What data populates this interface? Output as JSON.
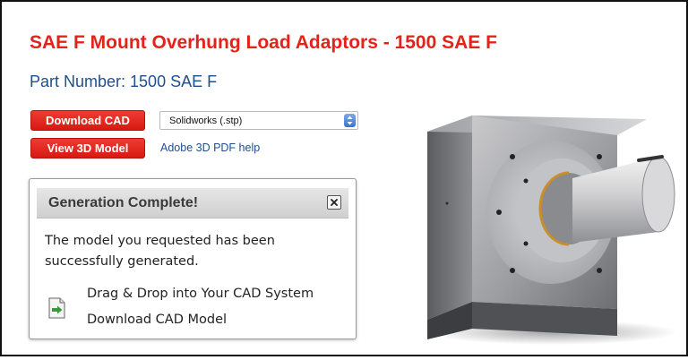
{
  "product": {
    "title": "SAE F Mount Overhung Load Adaptors - 1500 SAE F",
    "part_number": "Part Number: 1500 SAE F"
  },
  "actions": {
    "download_cad_label": "Download CAD",
    "view_3d_label": "View 3D Model",
    "format_selected": "Solidworks (.stp)",
    "pdf_help_link": "Adobe 3D PDF help"
  },
  "panel": {
    "title": "Generation Complete!",
    "message": "The model you requested has been successfully generated.",
    "drag_drop": "Drag & Drop into Your CAD System",
    "download_model": "Download CAD Model"
  },
  "icons": {
    "close": "close-icon",
    "select_arrow": "select-arrow-icon",
    "download": "cad-download-icon",
    "preview": "adaptor-model-image"
  },
  "colors": {
    "title": "#e3231b",
    "part_number": "#1f4f8f",
    "button": "#e3231b",
    "link": "#1f4f8f"
  }
}
